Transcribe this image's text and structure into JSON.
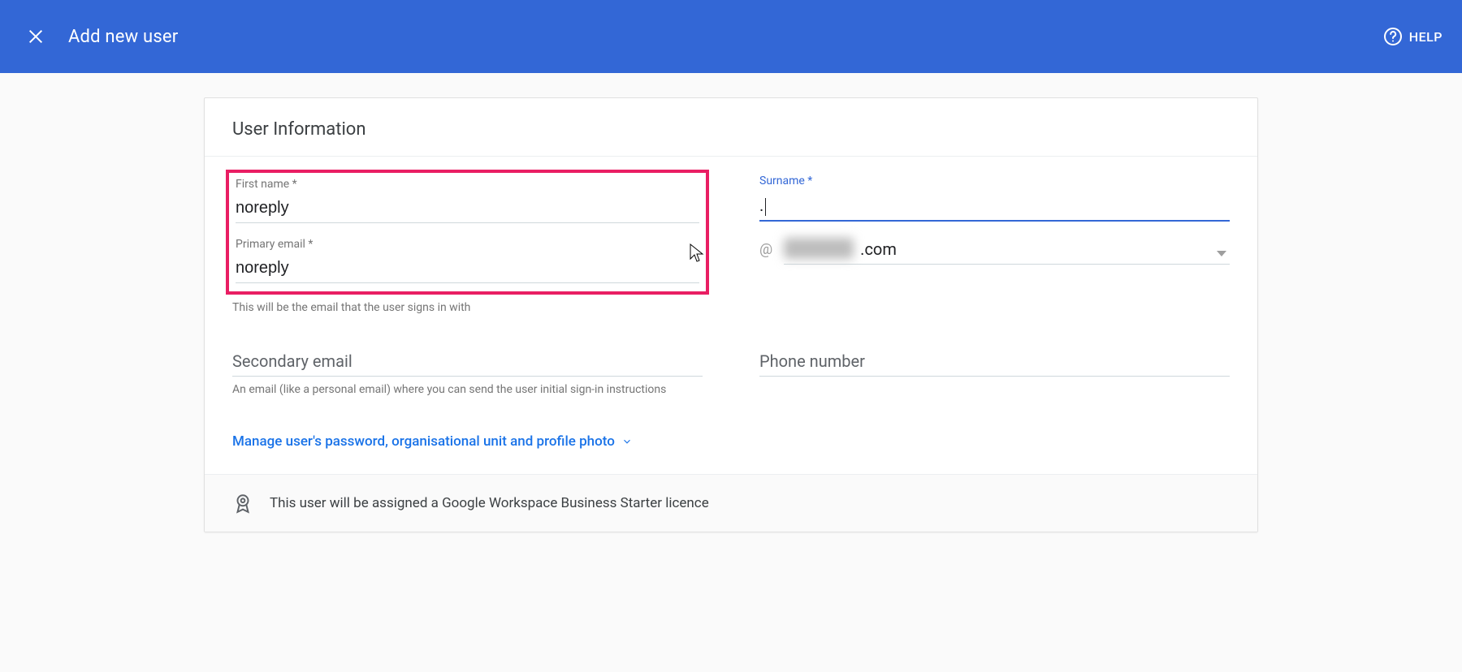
{
  "header": {
    "title": "Add new user",
    "help_label": "HELP"
  },
  "section_title": "User Information",
  "fields": {
    "first_name": {
      "label": "First name *",
      "value": "noreply"
    },
    "surname": {
      "label": "Surname *",
      "value": "."
    },
    "primary_email": {
      "label": "Primary email *",
      "value": "noreply",
      "helper": "This will be the email that the user signs in with"
    },
    "domain": {
      "at": "@",
      "value": ".com"
    },
    "secondary_email": {
      "label": "Secondary email",
      "helper": "An email (like a personal email) where you can send the user initial sign-in instructions"
    },
    "phone": {
      "label": "Phone number"
    }
  },
  "manage_link": "Manage user's password, organisational unit and profile photo",
  "licence_notice": "This user will be assigned a Google Workspace Business Starter licence"
}
